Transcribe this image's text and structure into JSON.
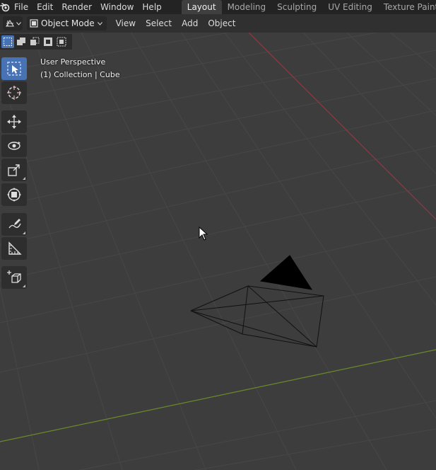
{
  "menu": {
    "items": [
      "File",
      "Edit",
      "Render",
      "Window",
      "Help"
    ]
  },
  "workspaces": {
    "tabs": [
      "Layout",
      "Modeling",
      "Sculpting",
      "UV Editing",
      "Texture Paint"
    ],
    "active": "Layout"
  },
  "viewport_header": {
    "mode": "Object Mode",
    "menus": [
      "View",
      "Select",
      "Add",
      "Object"
    ]
  },
  "overlay": {
    "perspective": "User Perspective",
    "collection": "(1) Collection | Cube"
  },
  "toolbar": {
    "tools": [
      "select-box",
      "cursor",
      "move",
      "rotate",
      "scale",
      "transform",
      "annotate",
      "measure",
      "add-cube"
    ]
  },
  "colors": {
    "accent": "#4772b3",
    "x_axis": "#8e3a3f",
    "y_axis": "#6b8a2a",
    "grid": "#474747",
    "background": "#3d3d3d"
  }
}
